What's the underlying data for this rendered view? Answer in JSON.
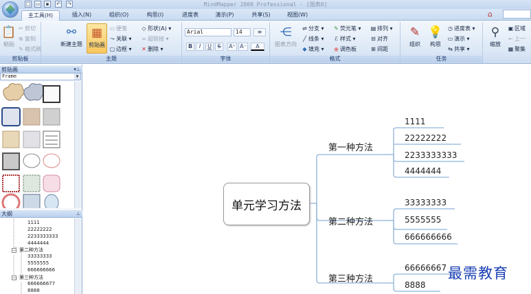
{
  "app": {
    "title": "MindMapper 2009 Professional - [图表0]"
  },
  "tabs": [
    {
      "label": "主工具(H)",
      "active": true
    },
    {
      "label": "插入(N)"
    },
    {
      "label": "组织(O)"
    },
    {
      "label": "构思(I)"
    },
    {
      "label": "进度表"
    },
    {
      "label": "演示(P)"
    },
    {
      "label": "共享(S)"
    },
    {
      "label": "视图(W)"
    }
  ],
  "ribbon": {
    "clipboard": {
      "label": "剪贴板",
      "paste": "粘贴",
      "cut": "剪切",
      "copy": "复制",
      "format_painter": "格式刷"
    },
    "topic": {
      "label": "主题",
      "new_topic": "新建主题",
      "clipart": "剪贴画",
      "note": "便笺",
      "relation": "关联",
      "border": "边框",
      "shape": "形状(A)",
      "hyperlink": "超链接",
      "delete": "删除"
    },
    "font": {
      "label": "字体",
      "family": "Arial",
      "size": "14"
    },
    "format": {
      "label": "格式",
      "diagram_direction": "图表方向",
      "branch": "分支",
      "line": "线条",
      "fill": "填充",
      "highlighter": "荧光笔",
      "style": "样式",
      "palette": "调色板",
      "arrange": "排列",
      "align": "对齐",
      "spacing": "间距"
    },
    "task": {
      "label": "任务",
      "organize": "组织",
      "ideas": "构思",
      "schedule": "进度表",
      "present": "演示",
      "share": "共享"
    },
    "view": {
      "zoom": "缩放",
      "region": "区域",
      "prev": "上一",
      "aggregate": "聚集"
    }
  },
  "panels": {
    "clipart": {
      "title": "剪贴画",
      "category": "Frame"
    },
    "outline": {
      "title": "大纲",
      "items": [
        {
          "text": "1111"
        },
        {
          "text": "22222222"
        },
        {
          "text": "2233333333"
        },
        {
          "text": "4444444"
        },
        {
          "text": "第二种方法"
        },
        {
          "text": "33333333"
        },
        {
          "text": "5555555"
        },
        {
          "text": "666666666"
        },
        {
          "text": "第三种方法"
        },
        {
          "text": "666666677"
        },
        {
          "text": "8888"
        }
      ]
    }
  },
  "mindmap": {
    "central": "单元学习方法",
    "branches": [
      {
        "label": "第一种方法",
        "children": [
          "1111",
          "22222222",
          "2233333333",
          "4444444"
        ]
      },
      {
        "label": "第二种方法",
        "children": [
          "33333333",
          "5555555",
          "666666666"
        ]
      },
      {
        "label": "第三种方法",
        "children": [
          "66666667",
          "8888"
        ]
      }
    ]
  },
  "watermark": "最需教育",
  "colors": {
    "ribbon": "#dce8f6",
    "branch_line": "#8fb3d9",
    "central_border": "#9a9a9a",
    "watermark": "#1a3fb3"
  }
}
